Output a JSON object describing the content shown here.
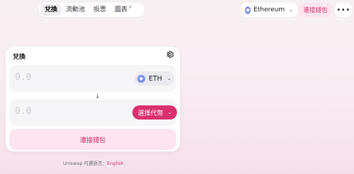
{
  "nav": {
    "items": [
      {
        "label": "兌換",
        "active": true
      },
      {
        "label": "流動池",
        "active": false
      },
      {
        "label": "投票",
        "active": false
      },
      {
        "label": "圖表",
        "active": false,
        "external": true
      }
    ],
    "external_icon": "↗"
  },
  "network": {
    "label": "Ethereum",
    "icon": "ethereum-icon"
  },
  "header_connect_label": "連接錢包",
  "more_label": "•••",
  "swap": {
    "title": "兌換",
    "settings_icon": "gear-icon",
    "input": {
      "amount_placeholder": "0.0",
      "token": "ETH"
    },
    "output": {
      "amount_placeholder": "0.0",
      "select_label": "選擇代幣"
    },
    "switch_icon": "↓",
    "connect_label": "連接錢包"
  },
  "footer": {
    "text": "Uniswap 可選語言：",
    "language": "English"
  },
  "colors": {
    "accent": "#d9306f",
    "accent_soft": "#fde4ef",
    "eth": "#7f8fe6"
  }
}
